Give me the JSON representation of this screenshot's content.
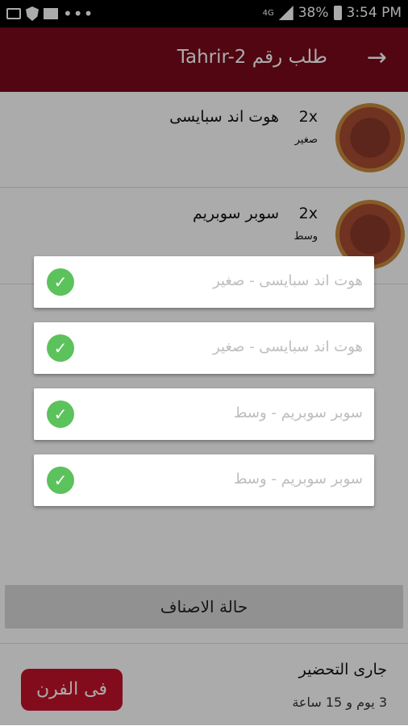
{
  "status_bar": {
    "time": "3:54 PM",
    "battery": "38%",
    "network": "4G"
  },
  "header": {
    "title": "طلب رقم Tahrir-2",
    "back_icon": "arrow-right-icon"
  },
  "order_items": [
    {
      "qty": "2x",
      "name": "هوت اند سبايسى",
      "size": "صغير"
    },
    {
      "qty": "2x",
      "name": "سوبر سوبريم",
      "size": "وسط"
    }
  ],
  "dialog_items": [
    {
      "label": "هوت اند سبايسى - صغير",
      "checked": true
    },
    {
      "label": "هوت اند سبايسى - صغير",
      "checked": true
    },
    {
      "label": "سوبر سوبريم - وسط",
      "checked": true
    },
    {
      "label": "سوبر سوبريم - وسط",
      "checked": true
    }
  ],
  "items_status_button": "حالة الاصناف",
  "preparation": {
    "title": "جارى التحضير",
    "elapsed": "3 يوم و 15 ساعة"
  },
  "oven_button": "فى الفرن",
  "colors": {
    "header": "#7a0a1a",
    "accent": "#c4122a",
    "check": "#5cc25c"
  }
}
